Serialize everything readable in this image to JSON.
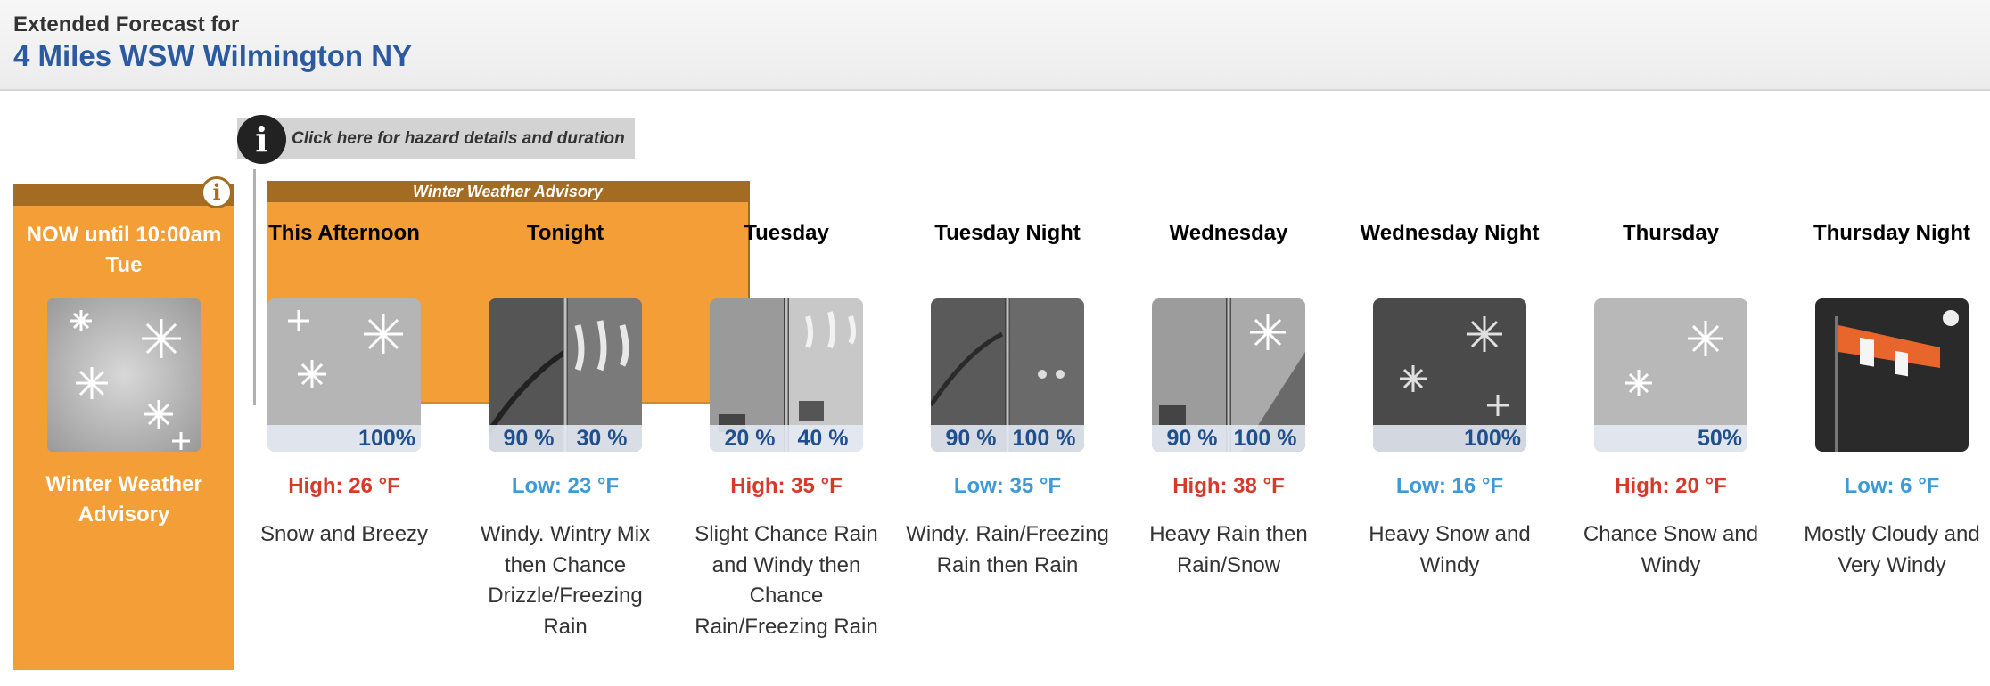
{
  "header": {
    "label": "Extended Forecast for",
    "location": "4 Miles WSW Wilmington NY"
  },
  "hazard_link": {
    "icon": "info-icon",
    "text": "Click here for hazard details and duration"
  },
  "now_panel": {
    "title": "NOW until 10:00am Tue",
    "hazard": "Winter Weather Advisory",
    "icon": "info-icon",
    "color": "#f39e36"
  },
  "advisory_banner": "Winter Weather Advisory",
  "periods": [
    {
      "name": "This Afternoon",
      "pop": "100%",
      "temp": "High: 26 °F",
      "desc": "Snow and Breezy",
      "icon": "snow-icon"
    },
    {
      "name": "Tonight",
      "pop_left": "90 %",
      "pop_right": "30 %",
      "temp": "Low: 23 °F",
      "desc": "Windy. Wintry Mix then Chance Drizzle/Freezing Rain",
      "icon": "freezing-rain-icon"
    },
    {
      "name": "Tuesday",
      "pop_left": "20 %",
      "pop_right": "40 %",
      "temp": "High: 35 °F",
      "desc": "Slight Chance Rain and Windy then Chance Rain/Freezing Rain",
      "icon": "rain-freezing-rain-icon"
    },
    {
      "name": "Tuesday Night",
      "pop_left": "90 %",
      "pop_right": "100 %",
      "temp": "Low: 35 °F",
      "desc": "Windy. Rain/Freezing Rain then Rain",
      "icon": "rain-icon"
    },
    {
      "name": "Wednesday",
      "pop_left": "90 %",
      "pop_right": "100 %",
      "temp": "High: 38 °F",
      "desc": "Heavy Rain then Rain/Snow",
      "icon": "rain-snow-icon"
    },
    {
      "name": "Wednesday Night",
      "pop": "100%",
      "temp": "Low: 16 °F",
      "desc": "Heavy Snow and Windy",
      "icon": "night-snow-icon"
    },
    {
      "name": "Thursday",
      "pop": "50%",
      "temp": "High: 20 °F",
      "desc": "Chance Snow and Windy",
      "icon": "snow-icon"
    },
    {
      "name": "Thursday Night",
      "temp": "Low: 6 °F",
      "desc": "Mostly Cloudy and Very Windy",
      "icon": "windsock-icon"
    }
  ]
}
